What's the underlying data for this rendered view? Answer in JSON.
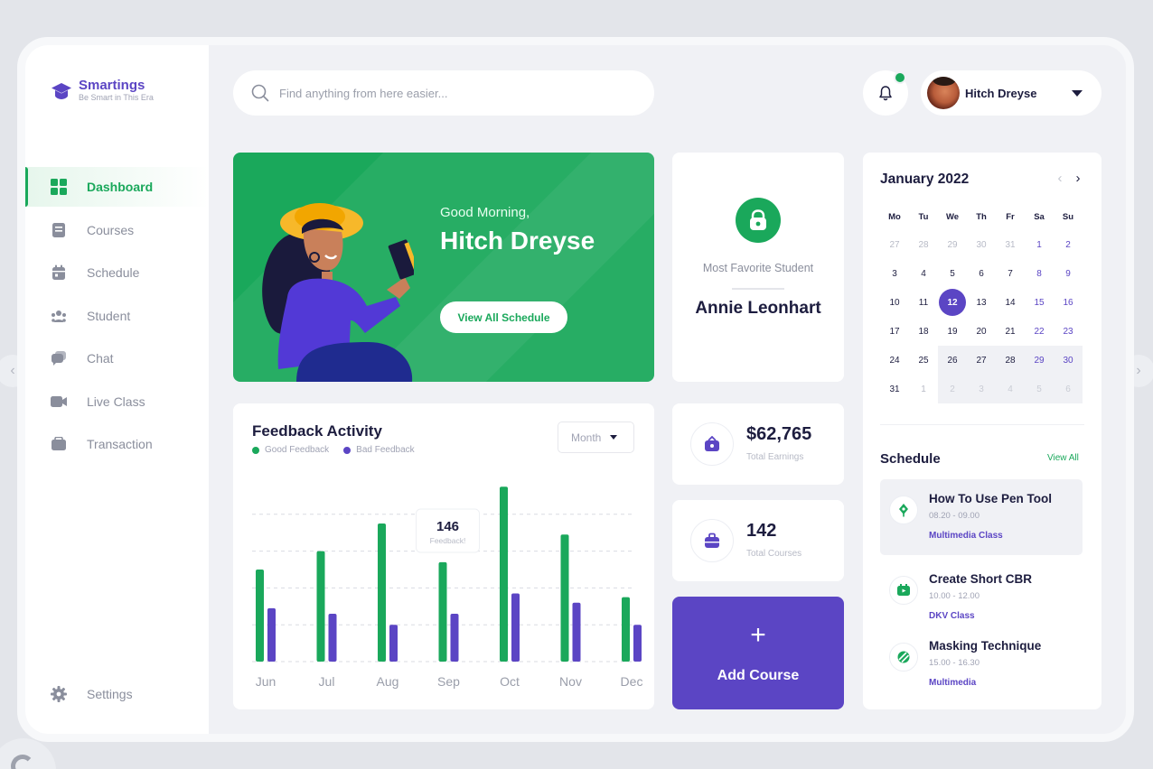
{
  "brand": {
    "name": "Smartings",
    "tagline": "Be Smart in This Era"
  },
  "nav": {
    "items": [
      {
        "label": "Dashboard",
        "icon": "grid-icon",
        "active": true
      },
      {
        "label": "Courses",
        "icon": "book-icon",
        "active": false
      },
      {
        "label": "Schedule",
        "icon": "calendar-icon",
        "active": false
      },
      {
        "label": "Student",
        "icon": "users-icon",
        "active": false
      },
      {
        "label": "Chat",
        "icon": "chat-icon",
        "active": false
      },
      {
        "label": "Live Class",
        "icon": "video-icon",
        "active": false
      },
      {
        "label": "Transaction",
        "icon": "wallet-icon",
        "active": false
      }
    ],
    "settings_label": "Settings"
  },
  "search": {
    "placeholder": "Find anything from here easier..."
  },
  "header": {
    "user_name": "Hitch Dreyse",
    "notification_dot": true
  },
  "hero": {
    "greeting": "Good Morning,",
    "name": "Hitch Dreyse",
    "button_label": "View All Schedule"
  },
  "favorite": {
    "label": "Most Favorite Student",
    "name": "Annie Leonhart"
  },
  "feedback": {
    "title": "Feedback Activity",
    "legend_good": "Good Feedback",
    "legend_bad": "Bad Feedback",
    "period": "Month",
    "tooltip_value": "146",
    "tooltip_label": "Feedback!"
  },
  "chart_data": {
    "type": "bar",
    "categories": [
      "Jun",
      "Jul",
      "Aug",
      "Sep",
      "Oct",
      "Nov",
      "Dec"
    ],
    "series": [
      {
        "name": "Good Feedback",
        "color": "#1aa85b",
        "values": [
          100,
          120,
          150,
          108,
          190,
          138,
          70
        ]
      },
      {
        "name": "Bad Feedback",
        "color": "#5b45c4",
        "values": [
          58,
          52,
          40,
          52,
          74,
          64,
          40
        ]
      }
    ],
    "ylim": [
      0,
      200
    ],
    "grid": "dashed horizontal",
    "tooltip_category": "Sep",
    "tooltip_value": 146
  },
  "stats": [
    {
      "value": "$62,765",
      "label": "Total Earnings",
      "icon": "wallet-icon"
    },
    {
      "value": "142",
      "label": "Total Courses",
      "icon": "briefcase-icon"
    }
  ],
  "add_course": {
    "plus": "+",
    "label": "Add Course"
  },
  "calendar": {
    "title": "January 2022",
    "weekdays": [
      "Mo",
      "Tu",
      "We",
      "Th",
      "Fr",
      "Sa",
      "Su"
    ],
    "days": [
      [
        "27",
        "28",
        "29",
        "30",
        "31",
        "1",
        "2"
      ],
      [
        "3",
        "4",
        "5",
        "6",
        "7",
        "8",
        "9"
      ],
      [
        "10",
        "11",
        "12",
        "13",
        "14",
        "15",
        "16"
      ],
      [
        "17",
        "18",
        "19",
        "20",
        "21",
        "22",
        "23"
      ],
      [
        "24",
        "25",
        "26",
        "27",
        "28",
        "29",
        "30"
      ],
      [
        "31",
        "1",
        "2",
        "3",
        "4",
        "5",
        "6"
      ]
    ],
    "today": "12"
  },
  "schedule": {
    "title": "Schedule",
    "view_all": "View All",
    "items": [
      {
        "name": "How To Use Pen Tool",
        "time": "08.20 - 09.00",
        "tag": "Multimedia Class",
        "icon": "pen-tool-icon"
      },
      {
        "name": "Create Short CBR",
        "time": "10.00 - 12.00",
        "tag": "DKV Class",
        "icon": "film-icon"
      },
      {
        "name": "Masking Technique",
        "time": "15.00 - 16.30",
        "tag": "Multimedia",
        "icon": "mask-icon"
      }
    ]
  }
}
